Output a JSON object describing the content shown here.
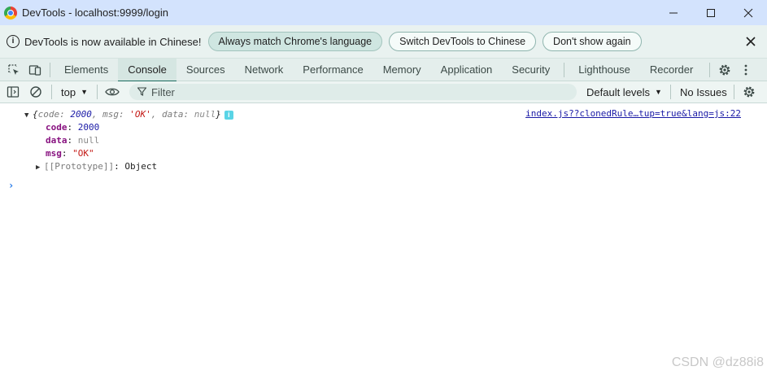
{
  "window": {
    "title": "DevTools - localhost:9999/login",
    "minimize_icon": "minimize-icon",
    "maximize_icon": "maximize-icon",
    "close_icon": "close-icon"
  },
  "infobar": {
    "message": "DevTools is now available in Chinese!",
    "buttons": [
      "Always match Chrome's language",
      "Switch DevTools to Chinese",
      "Don't show again"
    ]
  },
  "tabs": {
    "items": [
      "Elements",
      "Console",
      "Sources",
      "Network",
      "Performance",
      "Memory",
      "Application",
      "Security",
      "Lighthouse",
      "Recorder"
    ],
    "active": "Console"
  },
  "console_toolbar": {
    "context": "top",
    "filter_placeholder": "Filter",
    "levels": "Default levels",
    "issues": "No Issues"
  },
  "console": {
    "summary": {
      "open": "{",
      "k1": "code",
      "v1": "2000",
      "k2": "msg",
      "v2": "'OK'",
      "k3": "data",
      "v3": "null",
      "close": "}"
    },
    "source_link": "index.js??clonedRule…tup=true&lang=js:22",
    "props": [
      {
        "key": "code",
        "value": "2000"
      },
      {
        "key": "data",
        "value": "null"
      },
      {
        "key": "msg",
        "value": "\"OK\""
      }
    ],
    "prototype_key": "[[Prototype]]",
    "prototype_value": "Object",
    "prompt": "›"
  },
  "watermark": "CSDN @dz88i8"
}
